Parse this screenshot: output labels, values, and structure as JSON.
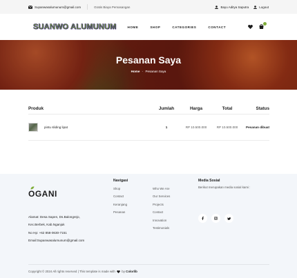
{
  "topbar": {
    "email": "Supanwasalumunum@gmail.com",
    "shipping": "Gratis Biaya Pemasangan",
    "user": "Bayu Aditya Saputra",
    "logout": "Logout"
  },
  "header": {
    "logo": "SUANWO ALUMUNUM",
    "nav": [
      {
        "label": "HOME"
      },
      {
        "label": "SHOP"
      },
      {
        "label": "CATEGORIES"
      },
      {
        "label": "CONTACT"
      }
    ]
  },
  "hero": {
    "title": "Pesanan Saya",
    "crumb_home": "Home",
    "crumb_sep": "-",
    "crumb_current": "Pesanan Saya"
  },
  "table": {
    "headers": {
      "product": "Produk",
      "qty": "Jumlah",
      "price": "Harga",
      "total": "Total",
      "status": "Status"
    },
    "rows": [
      {
        "product": "pintu sliding lipat",
        "qty": "1",
        "price": "RP 10.500.000",
        "total": "RP 10.500.000",
        "status": "Pesanan dibuat"
      }
    ]
  },
  "footer": {
    "logo": "OGANI",
    "info": [
      "Alamat: Desa Sapen, Ds.Balongrejo,",
      "Kec.Berbek, Kab.Nganjuk",
      "No Hp: +62 858-0630-7151",
      "Email:Supanwasalumunum@gmail.com"
    ],
    "nav_title": "Navigasi",
    "nav_col1": [
      "Shop",
      "Contact",
      "Keranjang",
      "Pesanan"
    ],
    "nav_col2": [
      "Who We Are",
      "Our Services",
      "Projects",
      "Contact",
      "Innovation",
      "Testimonials"
    ],
    "social_title": "Media Sosial",
    "social_text": "Berikut merupakan media sosial kami :",
    "copyright": "Copyright © 2024 All rights reserved | This template is made with",
    "by": "by",
    "brand": "Colorlib"
  },
  "colors": {
    "accent": "#7fad39",
    "logo_outline": "#3a2a70",
    "footer_bg": "#f3f6fa"
  }
}
